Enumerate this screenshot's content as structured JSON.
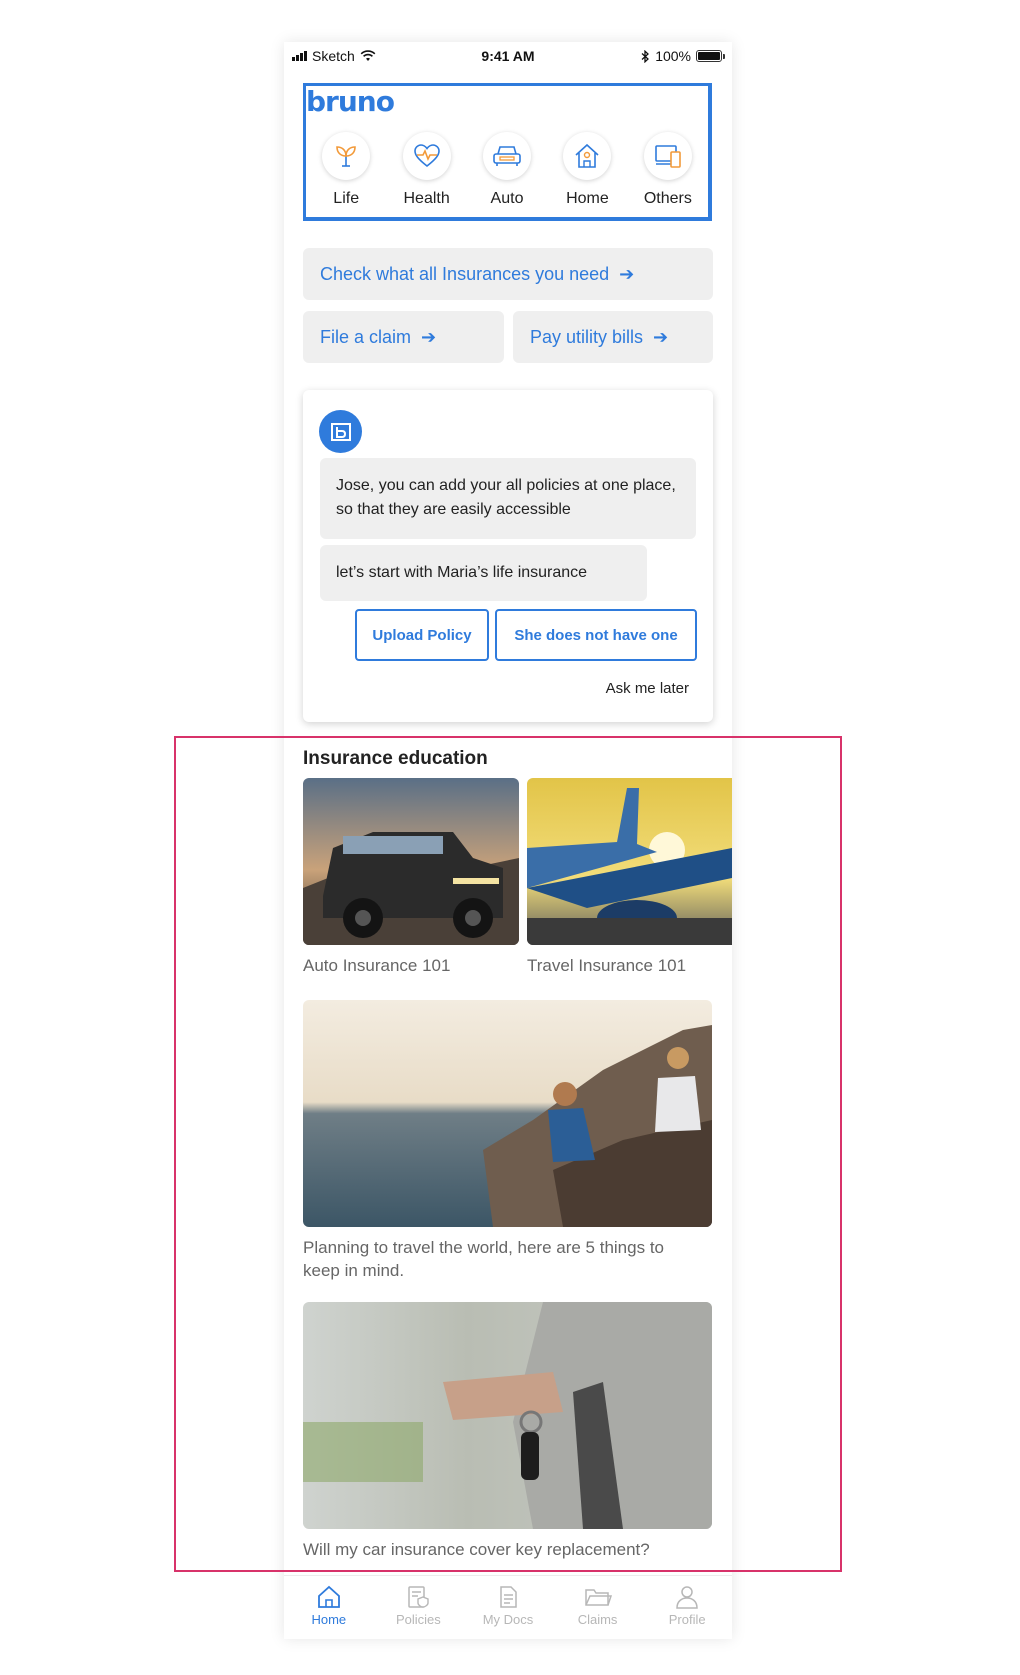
{
  "status_bar": {
    "carrier": "Sketch",
    "time": "9:41 AM",
    "battery": "100%"
  },
  "brand": {
    "logo": "bruno"
  },
  "categories": [
    {
      "label": "Life",
      "icon": "plant-icon"
    },
    {
      "label": "Health",
      "icon": "heart-pulse-icon"
    },
    {
      "label": "Auto",
      "icon": "car-icon"
    },
    {
      "label": "Home",
      "icon": "house-icon"
    },
    {
      "label": "Others",
      "icon": "devices-icon"
    }
  ],
  "quick_actions": [
    {
      "label": "Check what all Insurances you need",
      "icon": "arrow-right-icon"
    },
    {
      "label": "File a claim",
      "icon": "arrow-right-icon"
    },
    {
      "label": "Pay utility bills",
      "icon": "arrow-right-icon"
    }
  ],
  "bot": {
    "avatar_icon": "bruno-bot-icon",
    "messages": [
      "Jose, you can add your all policies at one place, so that they are easily accessible",
      "let’s start with Maria’s life insurance"
    ],
    "options": [
      "Upload Policy",
      "She does not have one"
    ],
    "ask_later": "Ask me later"
  },
  "education": {
    "title": "Insurance education",
    "cards": [
      {
        "caption": "Auto Insurance 101"
      },
      {
        "caption": "Travel Insurance 101"
      },
      {
        "caption": "Planning to travel the world, here are 5 things to keep in mind."
      },
      {
        "caption": "Will my car insurance cover key replacement?"
      }
    ]
  },
  "tabs": [
    {
      "label": "Home",
      "icon": "home-icon",
      "active": true
    },
    {
      "label": "Policies",
      "icon": "policy-shield-icon",
      "active": false
    },
    {
      "label": "My Docs",
      "icon": "document-icon",
      "active": false
    },
    {
      "label": "Claims",
      "icon": "folder-icon",
      "active": false
    },
    {
      "label": "Profile",
      "icon": "person-icon",
      "active": false
    }
  ],
  "colors": {
    "accent": "#2f7bdc",
    "orange": "#f29a3a",
    "highlight": "#d8326a",
    "chip_bg": "#efefef"
  }
}
